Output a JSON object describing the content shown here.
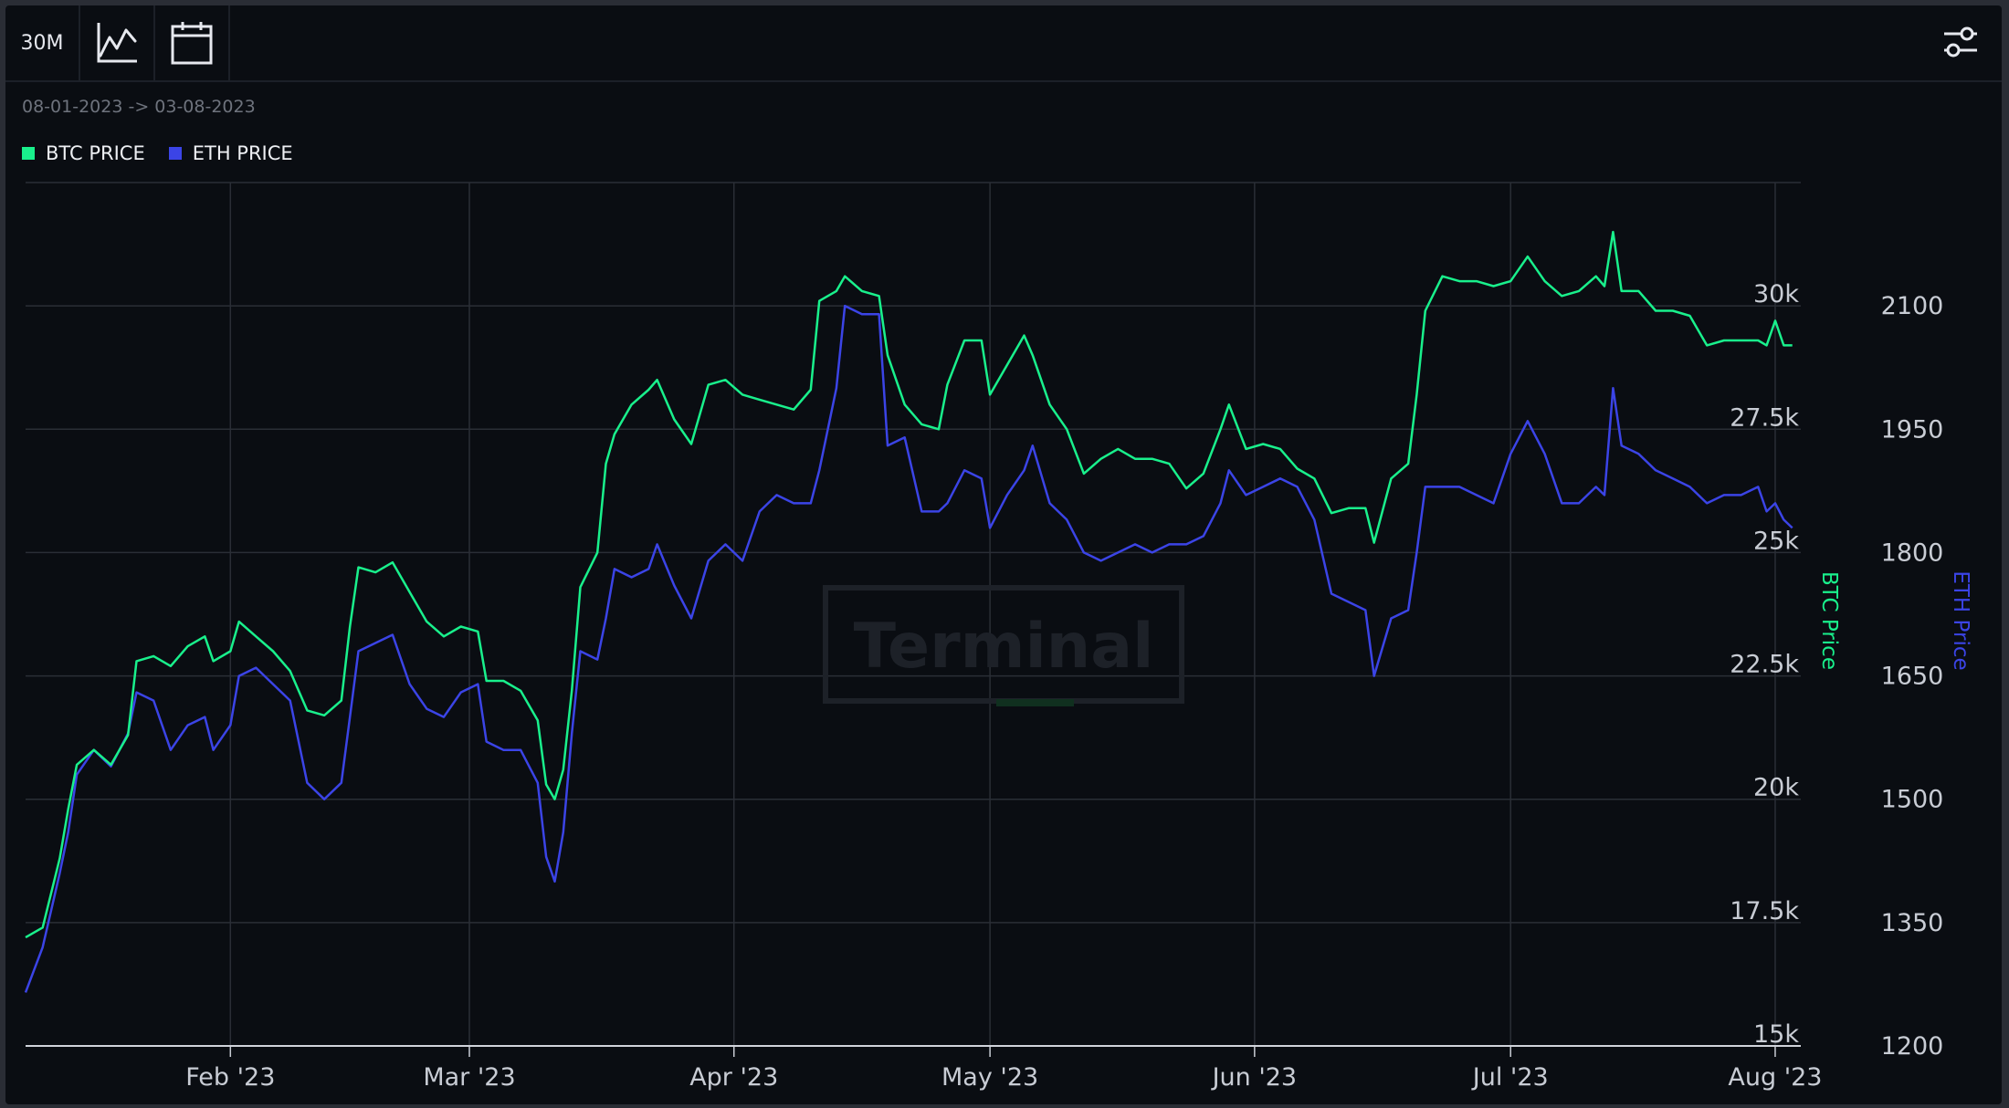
{
  "toolbar": {
    "timeframe_label": "30M",
    "chart_type_icon": "line-chart-icon",
    "date_icon": "calendar-icon",
    "settings_icon": "sliders-icon"
  },
  "date_range": "08-01-2023 -> 03-08-2023",
  "watermark": "Terminal",
  "colors": {
    "btc": "#19f08c",
    "eth": "#3b44e6",
    "background": "#0a0d12",
    "grid": "#2a2e36"
  },
  "chart_data": {
    "type": "line",
    "x_type": "date",
    "xlim": [
      "2023-01-08",
      "2023-08-04"
    ],
    "x_ticks": [
      {
        "date": "2023-02-01",
        "label": "Feb '23"
      },
      {
        "date": "2023-03-01",
        "label": "Mar '23"
      },
      {
        "date": "2023-04-01",
        "label": "Apr '23"
      },
      {
        "date": "2023-05-01",
        "label": "May '23"
      },
      {
        "date": "2023-06-01",
        "label": "Jun '23"
      },
      {
        "date": "2023-07-01",
        "label": "Jul '23"
      },
      {
        "date": "2023-08-01",
        "label": "Aug '23"
      }
    ],
    "y_axes": [
      {
        "label": "BTC Price",
        "series": "BTC PRICE",
        "ylim": [
          15000,
          32500
        ],
        "ticks": [
          15000,
          17500,
          20000,
          22500,
          25000,
          27500,
          30000
        ],
        "tick_labels": [
          "15k",
          "17.5k",
          "20k",
          "22.5k",
          "25k",
          "27.5k",
          "30k"
        ]
      },
      {
        "label": "ETH Price",
        "series": "ETH PRICE",
        "ylim": [
          1200,
          2250
        ],
        "ticks": [
          1200,
          1350,
          1500,
          1650,
          1800,
          1950,
          2100
        ],
        "tick_labels": [
          "1200",
          "1350",
          "1500",
          "1650",
          "1800",
          "1950",
          "2100"
        ]
      }
    ],
    "grid": true,
    "legend_position": "top-left",
    "series": [
      {
        "name": "BTC PRICE",
        "color": "#19f08c",
        "points": [
          [
            "2023-01-08",
            17200
          ],
          [
            "2023-01-10",
            17400
          ],
          [
            "2023-01-12",
            18800
          ],
          [
            "2023-01-13",
            19800
          ],
          [
            "2023-01-14",
            20700
          ],
          [
            "2023-01-16",
            21000
          ],
          [
            "2023-01-18",
            20700
          ],
          [
            "2023-01-20",
            21300
          ],
          [
            "2023-01-21",
            22800
          ],
          [
            "2023-01-23",
            22900
          ],
          [
            "2023-01-25",
            22700
          ],
          [
            "2023-01-27",
            23100
          ],
          [
            "2023-01-29",
            23300
          ],
          [
            "2023-01-30",
            22800
          ],
          [
            "2023-02-01",
            23000
          ],
          [
            "2023-02-02",
            23600
          ],
          [
            "2023-02-04",
            23300
          ],
          [
            "2023-02-06",
            23000
          ],
          [
            "2023-02-08",
            22600
          ],
          [
            "2023-02-10",
            21800
          ],
          [
            "2023-02-12",
            21700
          ],
          [
            "2023-02-14",
            22000
          ],
          [
            "2023-02-15",
            23500
          ],
          [
            "2023-02-16",
            24700
          ],
          [
            "2023-02-18",
            24600
          ],
          [
            "2023-02-20",
            24800
          ],
          [
            "2023-02-22",
            24200
          ],
          [
            "2023-02-24",
            23600
          ],
          [
            "2023-02-26",
            23300
          ],
          [
            "2023-02-28",
            23500
          ],
          [
            "2023-03-02",
            23400
          ],
          [
            "2023-03-03",
            22400
          ],
          [
            "2023-03-05",
            22400
          ],
          [
            "2023-03-07",
            22200
          ],
          [
            "2023-03-09",
            21600
          ],
          [
            "2023-03-10",
            20300
          ],
          [
            "2023-03-11",
            20000
          ],
          [
            "2023-03-12",
            20600
          ],
          [
            "2023-03-13",
            22200
          ],
          [
            "2023-03-14",
            24300
          ],
          [
            "2023-03-16",
            25000
          ],
          [
            "2023-03-17",
            26800
          ],
          [
            "2023-03-18",
            27400
          ],
          [
            "2023-03-20",
            28000
          ],
          [
            "2023-03-22",
            28300
          ],
          [
            "2023-03-23",
            28500
          ],
          [
            "2023-03-25",
            27700
          ],
          [
            "2023-03-27",
            27200
          ],
          [
            "2023-03-29",
            28400
          ],
          [
            "2023-03-31",
            28500
          ],
          [
            "2023-04-02",
            28200
          ],
          [
            "2023-04-04",
            28100
          ],
          [
            "2023-04-06",
            28000
          ],
          [
            "2023-04-08",
            27900
          ],
          [
            "2023-04-10",
            28300
          ],
          [
            "2023-04-11",
            30100
          ],
          [
            "2023-04-13",
            30300
          ],
          [
            "2023-04-14",
            30600
          ],
          [
            "2023-04-16",
            30300
          ],
          [
            "2023-04-18",
            30200
          ],
          [
            "2023-04-19",
            29000
          ],
          [
            "2023-04-21",
            28000
          ],
          [
            "2023-04-23",
            27600
          ],
          [
            "2023-04-25",
            27500
          ],
          [
            "2023-04-26",
            28400
          ],
          [
            "2023-04-28",
            29300
          ],
          [
            "2023-04-30",
            29300
          ],
          [
            "2023-05-01",
            28200
          ],
          [
            "2023-05-03",
            28800
          ],
          [
            "2023-05-05",
            29400
          ],
          [
            "2023-05-06",
            29000
          ],
          [
            "2023-05-08",
            28000
          ],
          [
            "2023-05-10",
            27500
          ],
          [
            "2023-05-12",
            26600
          ],
          [
            "2023-05-14",
            26900
          ],
          [
            "2023-05-16",
            27100
          ],
          [
            "2023-05-18",
            26900
          ],
          [
            "2023-05-20",
            26900
          ],
          [
            "2023-05-22",
            26800
          ],
          [
            "2023-05-24",
            26300
          ],
          [
            "2023-05-26",
            26600
          ],
          [
            "2023-05-28",
            27500
          ],
          [
            "2023-05-29",
            28000
          ],
          [
            "2023-05-31",
            27100
          ],
          [
            "2023-06-02",
            27200
          ],
          [
            "2023-06-04",
            27100
          ],
          [
            "2023-06-06",
            26700
          ],
          [
            "2023-06-08",
            26500
          ],
          [
            "2023-06-10",
            25800
          ],
          [
            "2023-06-12",
            25900
          ],
          [
            "2023-06-14",
            25900
          ],
          [
            "2023-06-15",
            25200
          ],
          [
            "2023-06-17",
            26500
          ],
          [
            "2023-06-19",
            26800
          ],
          [
            "2023-06-20",
            28200
          ],
          [
            "2023-06-21",
            29900
          ],
          [
            "2023-06-23",
            30600
          ],
          [
            "2023-06-25",
            30500
          ],
          [
            "2023-06-27",
            30500
          ],
          [
            "2023-06-29",
            30400
          ],
          [
            "2023-07-01",
            30500
          ],
          [
            "2023-07-03",
            31000
          ],
          [
            "2023-07-05",
            30500
          ],
          [
            "2023-07-07",
            30200
          ],
          [
            "2023-07-09",
            30300
          ],
          [
            "2023-07-11",
            30600
          ],
          [
            "2023-07-12",
            30400
          ],
          [
            "2023-07-13",
            31500
          ],
          [
            "2023-07-14",
            30300
          ],
          [
            "2023-07-16",
            30300
          ],
          [
            "2023-07-18",
            29900
          ],
          [
            "2023-07-20",
            29900
          ],
          [
            "2023-07-22",
            29800
          ],
          [
            "2023-07-24",
            29200
          ],
          [
            "2023-07-26",
            29300
          ],
          [
            "2023-07-28",
            29300
          ],
          [
            "2023-07-30",
            29300
          ],
          [
            "2023-07-31",
            29200
          ],
          [
            "2023-08-01",
            29700
          ],
          [
            "2023-08-02",
            29200
          ],
          [
            "2023-08-03",
            29200
          ]
        ]
      },
      {
        "name": "ETH PRICE",
        "color": "#3b44e6",
        "points": [
          [
            "2023-01-08",
            1265
          ],
          [
            "2023-01-10",
            1320
          ],
          [
            "2023-01-12",
            1410
          ],
          [
            "2023-01-13",
            1460
          ],
          [
            "2023-01-14",
            1530
          ],
          [
            "2023-01-16",
            1560
          ],
          [
            "2023-01-18",
            1540
          ],
          [
            "2023-01-20",
            1580
          ],
          [
            "2023-01-21",
            1630
          ],
          [
            "2023-01-23",
            1620
          ],
          [
            "2023-01-25",
            1560
          ],
          [
            "2023-01-27",
            1590
          ],
          [
            "2023-01-29",
            1600
          ],
          [
            "2023-01-30",
            1560
          ],
          [
            "2023-02-01",
            1590
          ],
          [
            "2023-02-02",
            1650
          ],
          [
            "2023-02-04",
            1660
          ],
          [
            "2023-02-06",
            1640
          ],
          [
            "2023-02-08",
            1620
          ],
          [
            "2023-02-10",
            1520
          ],
          [
            "2023-02-12",
            1500
          ],
          [
            "2023-02-14",
            1520
          ],
          [
            "2023-02-15",
            1600
          ],
          [
            "2023-02-16",
            1680
          ],
          [
            "2023-02-18",
            1690
          ],
          [
            "2023-02-20",
            1700
          ],
          [
            "2023-02-22",
            1640
          ],
          [
            "2023-02-24",
            1610
          ],
          [
            "2023-02-26",
            1600
          ],
          [
            "2023-02-28",
            1630
          ],
          [
            "2023-03-02",
            1640
          ],
          [
            "2023-03-03",
            1570
          ],
          [
            "2023-03-05",
            1560
          ],
          [
            "2023-03-07",
            1560
          ],
          [
            "2023-03-09",
            1520
          ],
          [
            "2023-03-10",
            1430
          ],
          [
            "2023-03-11",
            1400
          ],
          [
            "2023-03-12",
            1460
          ],
          [
            "2023-03-13",
            1580
          ],
          [
            "2023-03-14",
            1680
          ],
          [
            "2023-03-16",
            1670
          ],
          [
            "2023-03-17",
            1720
          ],
          [
            "2023-03-18",
            1780
          ],
          [
            "2023-03-20",
            1770
          ],
          [
            "2023-03-22",
            1780
          ],
          [
            "2023-03-23",
            1810
          ],
          [
            "2023-03-25",
            1760
          ],
          [
            "2023-03-27",
            1720
          ],
          [
            "2023-03-29",
            1790
          ],
          [
            "2023-03-31",
            1810
          ],
          [
            "2023-04-02",
            1790
          ],
          [
            "2023-04-04",
            1850
          ],
          [
            "2023-04-06",
            1870
          ],
          [
            "2023-04-08",
            1860
          ],
          [
            "2023-04-10",
            1860
          ],
          [
            "2023-04-11",
            1900
          ],
          [
            "2023-04-13",
            2000
          ],
          [
            "2023-04-14",
            2100
          ],
          [
            "2023-04-16",
            2090
          ],
          [
            "2023-04-18",
            2090
          ],
          [
            "2023-04-19",
            1930
          ],
          [
            "2023-04-21",
            1940
          ],
          [
            "2023-04-23",
            1850
          ],
          [
            "2023-04-25",
            1850
          ],
          [
            "2023-04-26",
            1860
          ],
          [
            "2023-04-28",
            1900
          ],
          [
            "2023-04-30",
            1890
          ],
          [
            "2023-05-01",
            1830
          ],
          [
            "2023-05-03",
            1870
          ],
          [
            "2023-05-05",
            1900
          ],
          [
            "2023-05-06",
            1930
          ],
          [
            "2023-05-08",
            1860
          ],
          [
            "2023-05-10",
            1840
          ],
          [
            "2023-05-12",
            1800
          ],
          [
            "2023-05-14",
            1790
          ],
          [
            "2023-05-16",
            1800
          ],
          [
            "2023-05-18",
            1810
          ],
          [
            "2023-05-20",
            1800
          ],
          [
            "2023-05-22",
            1810
          ],
          [
            "2023-05-24",
            1810
          ],
          [
            "2023-05-26",
            1820
          ],
          [
            "2023-05-28",
            1860
          ],
          [
            "2023-05-29",
            1900
          ],
          [
            "2023-05-31",
            1870
          ],
          [
            "2023-06-02",
            1880
          ],
          [
            "2023-06-04",
            1890
          ],
          [
            "2023-06-06",
            1880
          ],
          [
            "2023-06-08",
            1840
          ],
          [
            "2023-06-10",
            1750
          ],
          [
            "2023-06-12",
            1740
          ],
          [
            "2023-06-14",
            1730
          ],
          [
            "2023-06-15",
            1650
          ],
          [
            "2023-06-17",
            1720
          ],
          [
            "2023-06-19",
            1730
          ],
          [
            "2023-06-20",
            1800
          ],
          [
            "2023-06-21",
            1880
          ],
          [
            "2023-06-23",
            1880
          ],
          [
            "2023-06-25",
            1880
          ],
          [
            "2023-06-27",
            1870
          ],
          [
            "2023-06-29",
            1860
          ],
          [
            "2023-07-01",
            1920
          ],
          [
            "2023-07-03",
            1960
          ],
          [
            "2023-07-05",
            1920
          ],
          [
            "2023-07-07",
            1860
          ],
          [
            "2023-07-09",
            1860
          ],
          [
            "2023-07-11",
            1880
          ],
          [
            "2023-07-12",
            1870
          ],
          [
            "2023-07-13",
            2000
          ],
          [
            "2023-07-14",
            1930
          ],
          [
            "2023-07-16",
            1920
          ],
          [
            "2023-07-18",
            1900
          ],
          [
            "2023-07-20",
            1890
          ],
          [
            "2023-07-22",
            1880
          ],
          [
            "2023-07-24",
            1860
          ],
          [
            "2023-07-26",
            1870
          ],
          [
            "2023-07-28",
            1870
          ],
          [
            "2023-07-30",
            1880
          ],
          [
            "2023-07-31",
            1850
          ],
          [
            "2023-08-01",
            1860
          ],
          [
            "2023-08-02",
            1840
          ],
          [
            "2023-08-03",
            1830
          ]
        ]
      }
    ]
  }
}
